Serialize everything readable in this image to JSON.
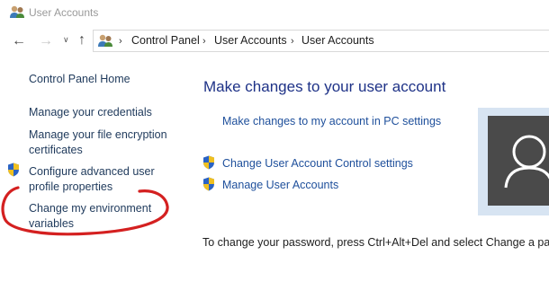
{
  "window": {
    "title": "User Accounts"
  },
  "nav": {
    "icons": [
      "back-arrow-icon",
      "forward-arrow-icon",
      "chevron-down-icon",
      "up-arrow-icon",
      "user-accounts-icon"
    ],
    "breadcrumbs": [
      "Control Panel",
      "User Accounts",
      "User Accounts"
    ]
  },
  "sidebar": {
    "home": "Control Panel Home",
    "links": [
      {
        "label": "Manage your credentials"
      },
      {
        "label": "Manage your file encryption certificates"
      },
      {
        "label": "Configure advanced user profile properties",
        "icon": "shield-icon"
      },
      {
        "label": "Change my environment variables",
        "annotation": "red-hand-drawn-circle"
      }
    ]
  },
  "main": {
    "heading": "Make changes to your user account",
    "links": [
      {
        "label": "Make changes to my account in PC settings"
      },
      {
        "label": "Change User Account Control settings",
        "icon": "shield-icon"
      },
      {
        "label": "Manage User Accounts",
        "icon": "shield-icon"
      }
    ],
    "password_hint": "To change your password, press Ctrl+Alt+Del and select Change a passwo"
  },
  "colors": {
    "link": "#1e4f9b",
    "heading": "#1e3287",
    "annotation": "#d42020",
    "avatar_bg": "#4a4a4a",
    "avatar_frame": "#d7e4f2"
  }
}
